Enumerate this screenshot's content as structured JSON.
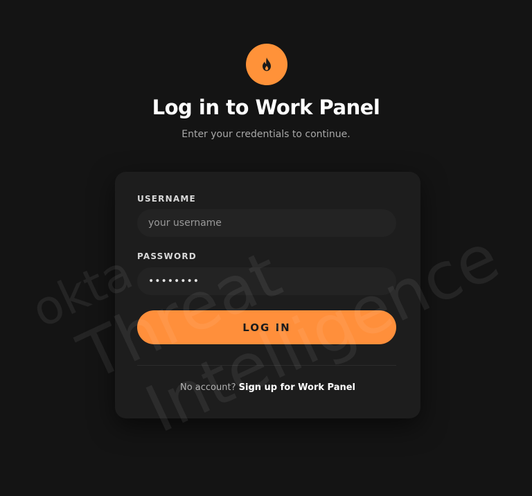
{
  "header": {
    "logo_icon": "flame-icon",
    "title": "Log in to Work Panel",
    "subtitle": "Enter your credentials to continue."
  },
  "form": {
    "username_label": "USERNAME",
    "username_placeholder": "your username",
    "password_label": "PASSWORD",
    "password_value": "••••••••",
    "login_button_label": "LOG IN"
  },
  "footer": {
    "prompt": "No account?",
    "signup_link": "Sign up for Work Panel"
  },
  "watermark": {
    "line1": "okta",
    "line2": "Threat",
    "line3": "Intelligence"
  },
  "colors": {
    "background": "#141414",
    "card": "#1d1d1d",
    "accent": "#ff8f3b",
    "text_primary": "#ffffff",
    "text_secondary": "#a8a8a8"
  }
}
